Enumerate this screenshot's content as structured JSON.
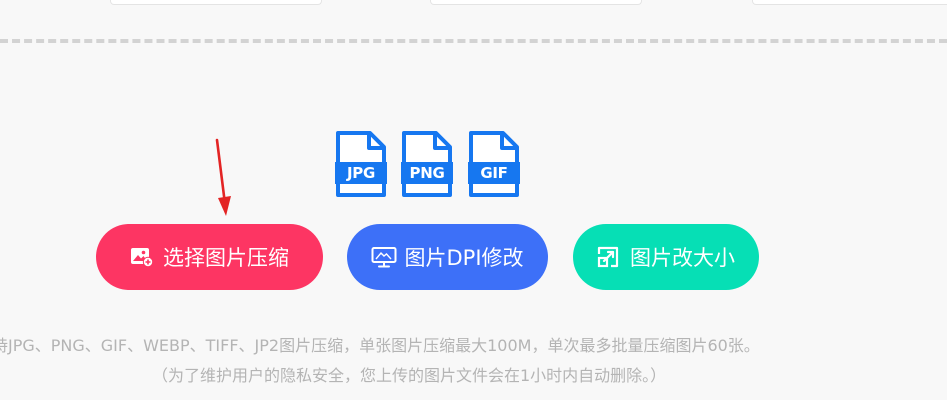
{
  "colors": {
    "compress_button": "#fd3563",
    "dpi_button": "#3d70f8",
    "resize_button": "#06dfb5",
    "file_icon": "#1677f0",
    "arrow": "#e32424",
    "note_text": "#b4b4b4"
  },
  "file_types": [
    {
      "ext": "JPG",
      "icon": "file-jpg-icon"
    },
    {
      "ext": "PNG",
      "icon": "file-png-icon"
    },
    {
      "ext": "GIF",
      "icon": "file-gif-icon"
    }
  ],
  "buttons": {
    "compress": {
      "label": "选择图片压缩",
      "icon": "image-add-icon"
    },
    "dpi": {
      "label": "图片DPI修改",
      "icon": "monitor-icon"
    },
    "resize": {
      "label": "图片改大小",
      "icon": "resize-icon"
    }
  },
  "notes": {
    "line1": "持JPG、PNG、GIF、WEBP、TIFF、JP2图片压缩，单张图片压缩最大100M，单次最多批量压缩图片60张。",
    "line2": "（为了维护用户的隐私安全，您上传的图片文件会在1小时内自动删除。）"
  }
}
